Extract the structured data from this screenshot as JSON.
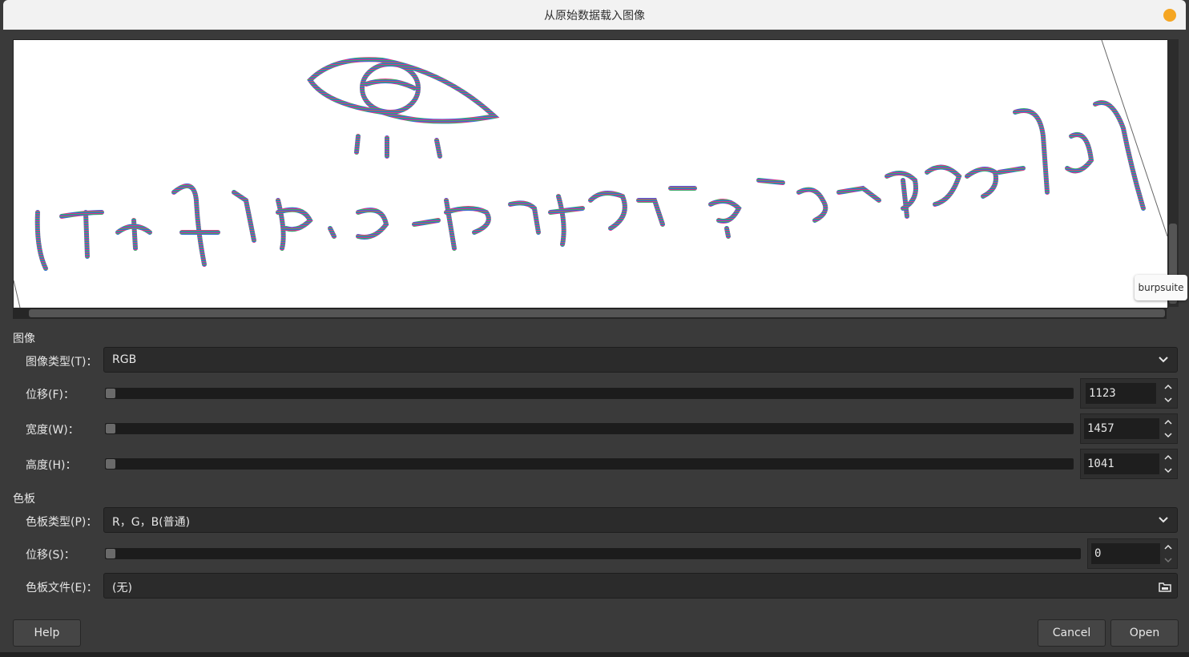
{
  "window": {
    "title": "从原始数据载入图像",
    "tooltip": "burpsuite"
  },
  "image_section": {
    "label": "图像",
    "type": {
      "label": "图像类型(T)：",
      "value": "RGB"
    },
    "offset": {
      "label": "位移(F)：",
      "value": "1123"
    },
    "width": {
      "label": "宽度(W)：",
      "value": "1457"
    },
    "height": {
      "label": "高度(H)：",
      "value": "1041"
    }
  },
  "palette_section": {
    "label": "色板",
    "type": {
      "label": "色板类型(P)：",
      "value": "R，G，B(普通)"
    },
    "offset": {
      "label": "位移(S)：",
      "value": "0"
    },
    "file": {
      "label": "色板文件(E)：",
      "value": "(无)"
    }
  },
  "buttons": {
    "help": "Help",
    "cancel": "Cancel",
    "open": "Open"
  },
  "icons": {
    "window_close": "orange-circle-icon",
    "dropdown": "chevron-down-icon",
    "spin_up": "spin-up-icon",
    "spin_down": "spin-down-icon",
    "file_open": "folder-icon"
  },
  "colors": {
    "window_button": "#f5a623",
    "background": "#3a3a3a"
  }
}
